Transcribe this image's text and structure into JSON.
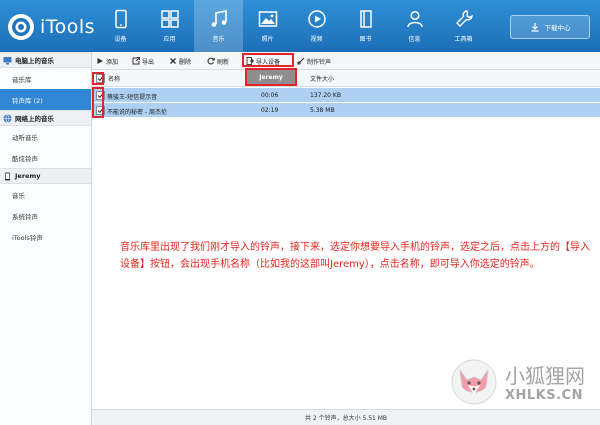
{
  "app": {
    "name": "iTools",
    "download_center": "下载中心"
  },
  "nav": [
    {
      "label": "设备",
      "icon": "device-icon"
    },
    {
      "label": "应用",
      "icon": "apps-icon"
    },
    {
      "label": "音乐",
      "icon": "music-icon",
      "active": true
    },
    {
      "label": "照片",
      "icon": "photo-icon"
    },
    {
      "label": "视频",
      "icon": "video-icon"
    },
    {
      "label": "图书",
      "icon": "book-icon"
    },
    {
      "label": "信息",
      "icon": "user-icon"
    },
    {
      "label": "工具箱",
      "icon": "toolbox-icon"
    }
  ],
  "sidebar": {
    "local": {
      "title": "电脑上的音乐",
      "items": [
        "音乐库",
        "铃声库 (2)"
      ]
    },
    "online": {
      "title": "网络上的音乐",
      "items": [
        "动听音乐",
        "酷炫铃声"
      ]
    },
    "device": {
      "title": "Jeremy",
      "items": [
        "音乐",
        "系统铃声",
        "iTools铃声"
      ]
    }
  },
  "toolbar": {
    "add": "添加",
    "export": "导出",
    "delete": "删除",
    "refresh": "刷新",
    "import_device": "导入设备",
    "make_ringtone": "制作铃声"
  },
  "popup": {
    "device_name": "Jeremy"
  },
  "table": {
    "col_name": "名称",
    "col_size": "文件大小",
    "rows": [
      {
        "name": "蔡骏王-短信提示音",
        "duration": "00:06",
        "size": "137.20 KB"
      },
      {
        "name": "不能说的秘密 - 周杰伦",
        "duration": "02:19",
        "size": "5.38 MB"
      }
    ]
  },
  "annotation": "音乐库里出现了我们刚才导入的铃声，接下来，选定你想要导入手机的铃声，选定之后，点击上方的【导入设备】按钮，会出现手机名称（比如我的这部叫Jeremy），点击名称，即可导入你选定的铃声。",
  "status": "共 2 个铃声，总大小 5.51 MB",
  "watermark": {
    "cn": "小狐狸网",
    "en": "XHLKS.CN"
  },
  "colors": {
    "header": "#1f77c2",
    "selected_row": "#aed1f3",
    "highlight_box": "#e0262a",
    "note_text": "#e4261f"
  }
}
